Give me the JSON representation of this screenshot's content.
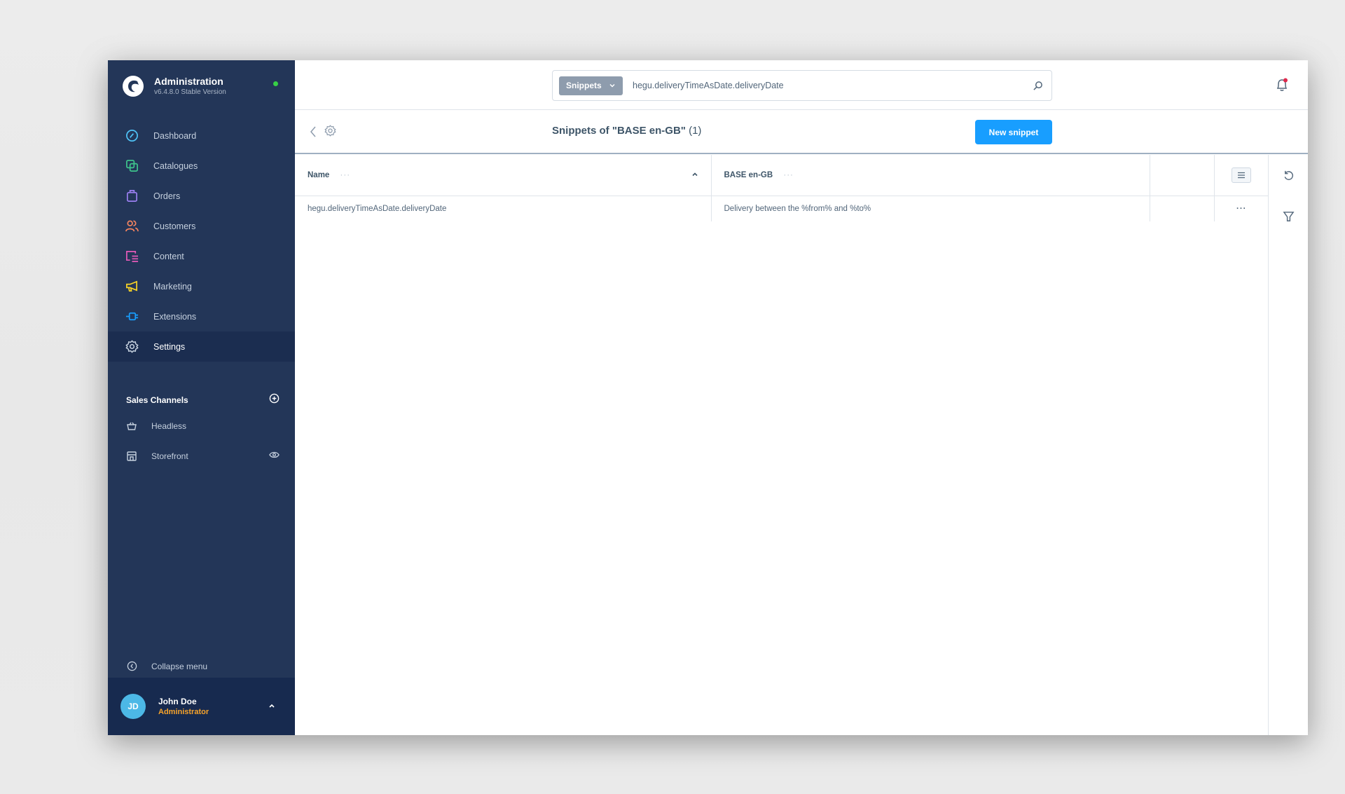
{
  "app": {
    "title": "Administration",
    "version": "v6.4.8.0 Stable Version",
    "status_color": "#37d046"
  },
  "sidebar": {
    "items": [
      {
        "label": "Dashboard",
        "icon": "dashboard-icon",
        "color": "#4fc3f7"
      },
      {
        "label": "Catalogues",
        "icon": "catalogues-icon",
        "color": "#3ec48c"
      },
      {
        "label": "Orders",
        "icon": "orders-icon",
        "color": "#9a7ff0"
      },
      {
        "label": "Customers",
        "icon": "customers-icon",
        "color": "#f4845f"
      },
      {
        "label": "Content",
        "icon": "content-icon",
        "color": "#e45ab9"
      },
      {
        "label": "Marketing",
        "icon": "marketing-icon",
        "color": "#f7d326"
      },
      {
        "label": "Extensions",
        "icon": "extensions-icon",
        "color": "#189eff"
      },
      {
        "label": "Settings",
        "icon": "settings-icon",
        "color": "#c5d0de",
        "active": true
      }
    ],
    "sales_channels": {
      "title": "Sales Channels",
      "items": [
        {
          "label": "Headless",
          "icon": "basket-icon"
        },
        {
          "label": "Storefront",
          "icon": "storefront-icon",
          "action_icon": "eye-icon"
        }
      ]
    },
    "collapse_label": "Collapse menu",
    "user": {
      "initials": "JD",
      "name": "John Doe",
      "role": "Administrator"
    }
  },
  "topbar": {
    "search_type": "Snippets",
    "search_value": "hegu.deliveryTimeAsDate.deliveryDate",
    "notification_badge_color": "#de294c"
  },
  "page": {
    "title": "Snippets of \"BASE en-GB\"",
    "count": "(1)",
    "new_button": "New snippet"
  },
  "table": {
    "columns": [
      {
        "label": "Name",
        "sorted": "ascending"
      },
      {
        "label": "BASE en-GB"
      }
    ],
    "rows": [
      {
        "name": "hegu.deliveryTimeAsDate.deliveryDate",
        "value": "Delivery between the %from% and %to%"
      }
    ],
    "row_action_label": "···",
    "column_menu_label": "···"
  },
  "colors": {
    "sidebar_bg": "#233658",
    "sidebar_active": "#1b2d50",
    "primary": "#189eff",
    "role_color": "#f7a32a",
    "avatar": "#4cb8e6"
  }
}
